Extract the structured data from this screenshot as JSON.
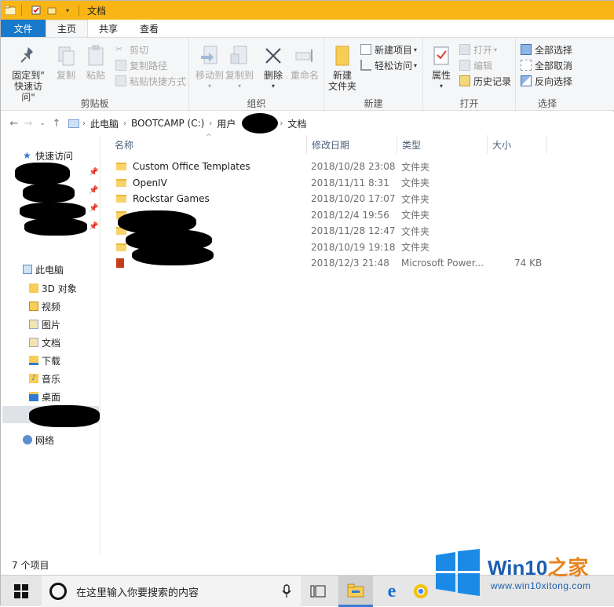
{
  "window": {
    "title": "文档"
  },
  "ribbon": {
    "tabs": [
      "文件",
      "主页",
      "共享",
      "查看"
    ],
    "clipboard": {
      "label": "剪贴板",
      "pin_quick_access": "固定到\"\n快速访问\"",
      "pin_line1": "固定到\"",
      "pin_line2": "快速访问\"",
      "copy": "复制",
      "paste": "粘贴",
      "cut": "剪切",
      "copy_path": "复制路径",
      "paste_shortcut": "粘贴快捷方式"
    },
    "organize": {
      "label": "组织",
      "move_to": "移动到",
      "copy_to": "复制到",
      "delete": "删除",
      "rename": "重命名"
    },
    "new": {
      "label": "新建",
      "new_folder_line1": "新建",
      "new_folder_line2": "文件夹",
      "new_item": "新建项目",
      "easy_access": "轻松访问"
    },
    "open": {
      "label": "打开",
      "properties": "属性",
      "open": "打开",
      "edit": "编辑",
      "history": "历史记录"
    },
    "select": {
      "label": "选择",
      "select_all": "全部选择",
      "select_none": "全部取消",
      "invert": "反向选择"
    }
  },
  "address": {
    "crumbs": [
      "此电脑",
      "BOOTCAMP (C:)",
      "用户",
      "文档"
    ]
  },
  "navpane": {
    "quick_access": "快速访问",
    "this_pc": "此电脑",
    "items": [
      "3D 对象",
      "视频",
      "图片",
      "文档",
      "下载",
      "音乐",
      "桌面"
    ],
    "network": "网络"
  },
  "filelist": {
    "headers": {
      "name": "名称",
      "date": "修改日期",
      "type": "类型",
      "size": "大小"
    },
    "rows": [
      {
        "name": "Custom Office Templates",
        "date": "2018/10/28 23:08",
        "type": "文件夹",
        "size": ""
      },
      {
        "name": "OpenIV",
        "date": "2018/11/11 8:31",
        "type": "文件夹",
        "size": ""
      },
      {
        "name": "Rockstar Games",
        "date": "2018/10/20 17:07",
        "type": "文件夹",
        "size": ""
      },
      {
        "name": "",
        "date": "2018/12/4 19:56",
        "type": "文件夹",
        "size": ""
      },
      {
        "name": "",
        "date": "2018/11/28 12:47",
        "type": "文件夹",
        "size": ""
      },
      {
        "name": "",
        "date": "2018/10/19 19:18",
        "type": "文件夹",
        "size": ""
      },
      {
        "name": "",
        "date": "2018/12/3 21:48",
        "type": "Microsoft Power...",
        "size": "74 KB"
      }
    ]
  },
  "status": {
    "item_count": "7 个项目"
  },
  "taskbar": {
    "search_placeholder": "在这里输入你要搜索的内容"
  },
  "watermark": {
    "title_prefix": "Win10",
    "title_suffix": "之家",
    "url": "www.win10xitong.com"
  },
  "colors": {
    "titlebar": "#f9b515",
    "file_tab": "#1979ca",
    "accent": "#1c5fb0"
  }
}
